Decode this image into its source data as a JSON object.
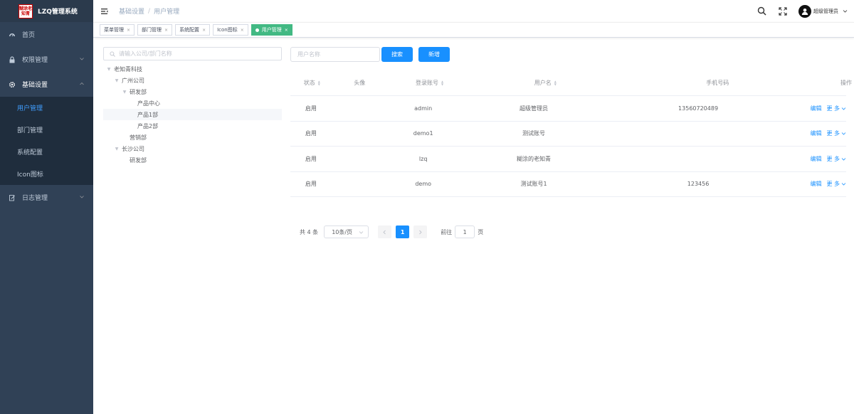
{
  "app": {
    "logo_text": "糊涂老知青",
    "title": "LZQ管理系统"
  },
  "sidebar": {
    "items": [
      {
        "label": "首页",
        "icon": "dashboard-icon"
      },
      {
        "label": "权限管理",
        "icon": "lock-icon"
      },
      {
        "label": "基础设置",
        "icon": "gear-icon"
      },
      {
        "label": "日志管理",
        "icon": "edit-icon"
      }
    ],
    "subitems": [
      {
        "label": "用户管理"
      },
      {
        "label": "部门管理"
      },
      {
        "label": "系统配置"
      },
      {
        "label": "Icon图标"
      }
    ]
  },
  "header": {
    "breadcrumb": [
      "基础设置",
      "用户管理"
    ],
    "breadcrumb_sep": "/",
    "username": "超级管理员"
  },
  "tags": [
    {
      "label": "菜单管理"
    },
    {
      "label": "部门管理"
    },
    {
      "label": "系统配置"
    },
    {
      "label": "Icon图标"
    },
    {
      "label": "用户管理",
      "active": true
    }
  ],
  "tree": {
    "search_placeholder": "请输入公司/部门名称",
    "nodes": [
      {
        "label": "老知青科技"
      },
      {
        "label": "广州公司"
      },
      {
        "label": "研发部"
      },
      {
        "label": "产品中心"
      },
      {
        "label": "产品1部"
      },
      {
        "label": "产品2部"
      },
      {
        "label": "营销部"
      },
      {
        "label": "长沙公司"
      },
      {
        "label": "研发部"
      }
    ]
  },
  "toolbar": {
    "search_placeholder": "用户名称",
    "search_label": "搜索",
    "add_label": "新增"
  },
  "table": {
    "columns": [
      "状态",
      "头像",
      "登录账号",
      "用户名",
      "手机号码",
      "操作"
    ],
    "rows": [
      {
        "status": "启用",
        "avatar": "",
        "account": "admin",
        "name": "超级管理员",
        "phone": "13560720489"
      },
      {
        "status": "启用",
        "avatar": "",
        "account": "demo1",
        "name": "测试账号",
        "phone": ""
      },
      {
        "status": "启用",
        "avatar": "",
        "account": "lzq",
        "name": "糊涂的老知青",
        "phone": ""
      },
      {
        "status": "启用",
        "avatar": "",
        "account": "demo",
        "name": "测试账号1",
        "phone": "123456"
      }
    ],
    "edit_label": "编辑",
    "more_label": "更 多"
  },
  "pagination": {
    "total_text": "共 4 条",
    "page_size": "10条/页",
    "current_page": "1",
    "goto_label": "前往",
    "goto_value": "1",
    "page_suffix": "页"
  },
  "colors": {
    "sidebar_bg": "#304156",
    "submenu_bg": "#1f2d3d",
    "primary": "#1890ff",
    "tag_active": "#42b983"
  }
}
